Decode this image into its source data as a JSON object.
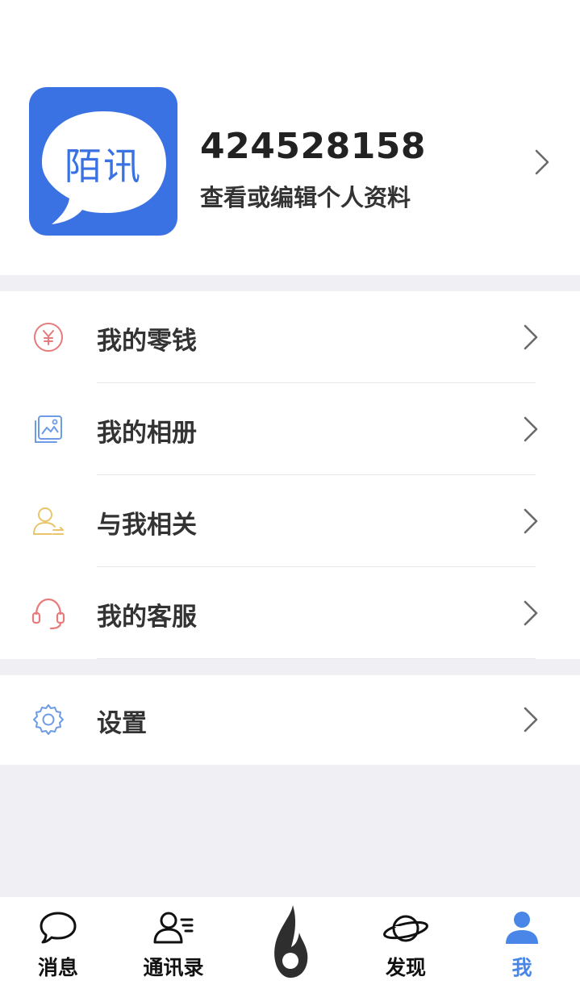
{
  "profile": {
    "logo_text": "陌讯",
    "user_id": "424528158",
    "hint": "查看或编辑个人资料"
  },
  "menu": {
    "group1": [
      {
        "label": "我的零钱",
        "icon": "wallet-yen-icon",
        "color": "#e77b7b"
      },
      {
        "label": "我的相册",
        "icon": "photo-album-icon",
        "color": "#6d9be6"
      },
      {
        "label": "与我相关",
        "icon": "user-related-icon",
        "color": "#e9c46a"
      },
      {
        "label": "我的客服",
        "icon": "headset-icon",
        "color": "#e77b7b"
      }
    ],
    "group2": [
      {
        "label": "设置",
        "icon": "gear-icon",
        "color": "#6d9be6"
      }
    ]
  },
  "tabbar": {
    "tabs": [
      {
        "label": "消息",
        "icon": "chat-bubble-icon"
      },
      {
        "label": "通讯录",
        "icon": "contacts-icon"
      },
      {
        "label": "",
        "icon": "flame-icon"
      },
      {
        "label": "发现",
        "icon": "planet-icon"
      },
      {
        "label": "我",
        "icon": "person-icon",
        "active": true
      }
    ],
    "active_color": "#4a86e8"
  },
  "colors": {
    "background": "#efeff4",
    "brand": "#3a72e4"
  }
}
